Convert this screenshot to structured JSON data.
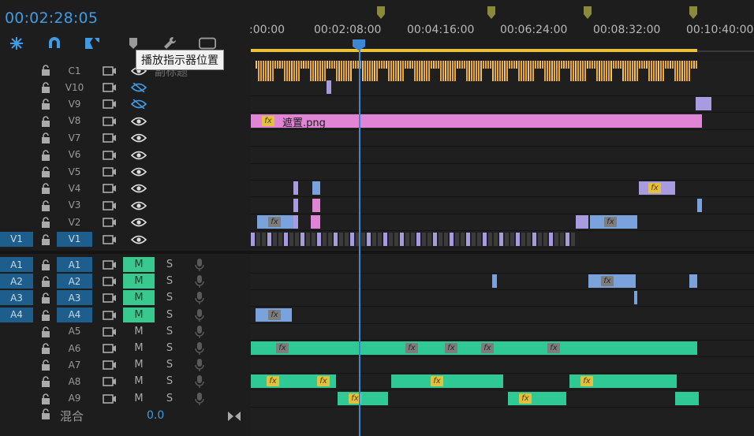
{
  "timecode": "00:02:28:05",
  "tooltip": "播放指示器位置",
  "ruler": {
    "labels": [
      ":00:00",
      "00:02:08:00",
      "00:04:16:00",
      "00:06:24:00",
      "00:08:32:00",
      "00:10:40:00"
    ]
  },
  "caption_track": {
    "name": "C1",
    "label": "副标题"
  },
  "video_tracks": [
    {
      "name": "V10",
      "eye": "hidden"
    },
    {
      "name": "V9",
      "eye": "hidden"
    },
    {
      "name": "V8",
      "eye": "visible"
    },
    {
      "name": "V7",
      "eye": "visible"
    },
    {
      "name": "V6",
      "eye": "visible"
    },
    {
      "name": "V5",
      "eye": "visible"
    },
    {
      "name": "V4",
      "eye": "visible"
    },
    {
      "name": "V3",
      "eye": "visible"
    },
    {
      "name": "V2",
      "eye": "visible"
    },
    {
      "name": "V1",
      "eye": "visible",
      "source": "V1",
      "active": true
    }
  ],
  "audio_tracks": [
    {
      "name": "A1",
      "source": "A1",
      "mute": "M",
      "solo": "S",
      "muted": true
    },
    {
      "name": "A2",
      "source": "A2",
      "mute": "M",
      "solo": "S",
      "muted": true
    },
    {
      "name": "A3",
      "source": "A3",
      "mute": "M",
      "solo": "S",
      "muted": true
    },
    {
      "name": "A4",
      "source": "A4",
      "mute": "M",
      "solo": "S",
      "muted": true
    },
    {
      "name": "A5",
      "source": "",
      "mute": "M",
      "solo": "S",
      "muted": false
    },
    {
      "name": "A6",
      "source": "",
      "mute": "M",
      "solo": "S",
      "muted": false
    },
    {
      "name": "A7",
      "source": "",
      "mute": "M",
      "solo": "S",
      "muted": false
    },
    {
      "name": "A8",
      "source": "",
      "mute": "M",
      "solo": "S",
      "muted": false
    },
    {
      "name": "A9",
      "source": "",
      "mute": "M",
      "solo": "S",
      "muted": false
    }
  ],
  "mix": {
    "label": "混合",
    "value": "0.0"
  },
  "clips": {
    "v8_label": "遮置.png",
    "fx": "fx"
  },
  "colors": {
    "accent": "#3c86d6",
    "pink_clip": "#e085d6",
    "purple_clip": "#a99be0",
    "blue_clip": "#7aa2dc",
    "green_clip": "#2ec994",
    "fx_badge": "#e2c23c",
    "caption_bars": "#e8a93a"
  }
}
